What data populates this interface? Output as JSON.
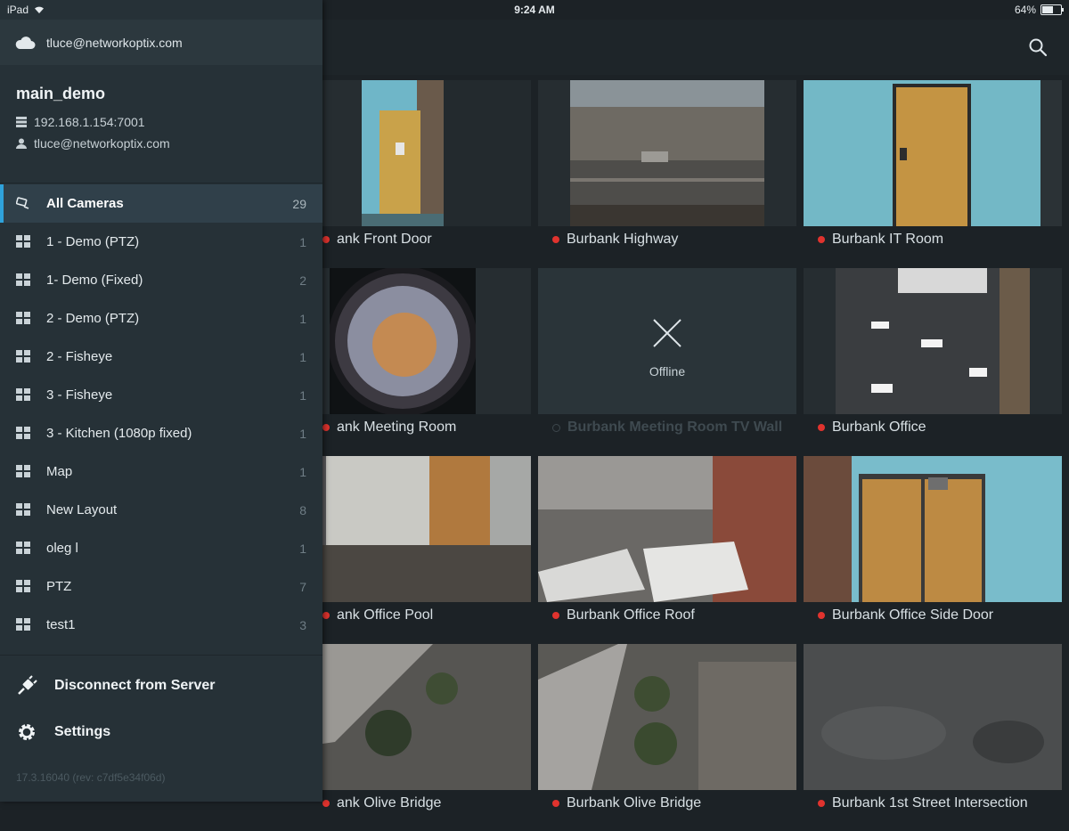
{
  "status_bar": {
    "device": "iPad",
    "time": "9:24 AM",
    "battery_percent": "64%",
    "battery_level": 0.64
  },
  "account": {
    "email": "tluce@networkoptix.com"
  },
  "server": {
    "name": "main_demo",
    "address": "192.168.1.154:7001",
    "user": "tluce@networkoptix.com"
  },
  "layouts": [
    {
      "label": "All Cameras",
      "count": "29",
      "active": true
    },
    {
      "label": "1 - Demo (PTZ)",
      "count": "1"
    },
    {
      "label": "1- Demo (Fixed)",
      "count": "2"
    },
    {
      "label": "2 - Demo (PTZ)",
      "count": "1"
    },
    {
      "label": "2 - Fisheye",
      "count": "1"
    },
    {
      "label": "3 - Fisheye",
      "count": "1"
    },
    {
      "label": "3 - Kitchen (1080p fixed)",
      "count": "1"
    },
    {
      "label": "Map",
      "count": "1"
    },
    {
      "label": "New Layout",
      "count": "8"
    },
    {
      "label": "oleg l",
      "count": "1"
    },
    {
      "label": "PTZ",
      "count": "7"
    },
    {
      "label": "test1",
      "count": "3"
    }
  ],
  "actions": {
    "disconnect": "Disconnect from Server",
    "settings": "Settings"
  },
  "version": "17.3.16040 (rev: c7df5e34f06d)",
  "cameras": [
    {
      "caption": "ank Front Door",
      "status": "none"
    },
    {
      "caption": "Burbank Highway",
      "status": "recording"
    },
    {
      "caption": "Burbank IT Room",
      "status": "recording"
    },
    {
      "caption": "ank Meeting Room",
      "status": "none"
    },
    {
      "caption": "Burbank Meeting Room TV Wall",
      "status": "offline",
      "offline_label": "Offline"
    },
    {
      "caption": "Burbank Office",
      "status": "recording"
    },
    {
      "caption": "ank Office Pool",
      "status": "none"
    },
    {
      "caption": "Burbank Office Roof",
      "status": "recording"
    },
    {
      "caption": "Burbank Office Side Door",
      "status": "recording"
    },
    {
      "caption": "ank Olive Bridge",
      "status": "none"
    },
    {
      "caption": "Burbank Olive Bridge",
      "status": "recording"
    },
    {
      "caption": "Burbank 1st Street Intersection",
      "status": "recording"
    }
  ],
  "icons": {
    "cloud": "cloud-icon",
    "server": "server-icon",
    "user": "user-icon",
    "all_cameras": "cameras-icon",
    "layout": "layout-grid-icon",
    "disconnect": "plug-icon",
    "settings": "gear-icon",
    "search": "search-icon"
  },
  "colors": {
    "accent": "#2fa2db",
    "recording": "#e0332e",
    "sidebar": "#263137",
    "background": "#1c2226"
  }
}
